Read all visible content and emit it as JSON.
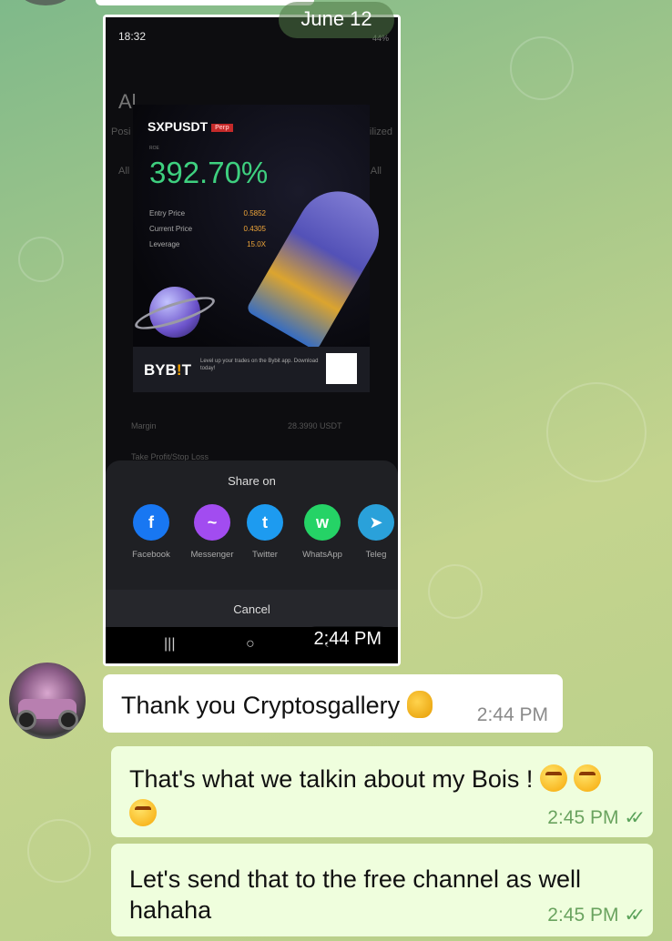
{
  "date_pill": "June 12",
  "screenshot": {
    "status_time": "18:32",
    "status_battery": "44%",
    "bg_letters": "Al",
    "bg_tab_left": "Posi",
    "bg_tab_right": "ilized",
    "bg_chip_left": "All",
    "bg_chip_right": "All",
    "bg_margin_label": "Margin",
    "bg_margin_value": "28.3990 USDT",
    "bg_tpsl_label": "Take Profit/Stop Loss",
    "card": {
      "pair": "SXPUSDT",
      "tag": "Perp",
      "roe_label": "ROE",
      "roe": "392.70%",
      "entry_label": "Entry Price",
      "entry_value": "0.5852",
      "current_label": "Current Price",
      "current_value": "0.4305",
      "leverage_label": "Leverage",
      "leverage_value": "15.0X",
      "logo_main": "BYB",
      "logo_accent": "!",
      "logo_end": "T",
      "tagline": "Level up your trades on the Bybit app. Download today!"
    },
    "share": {
      "title": "Share on",
      "items": [
        {
          "label": "Facebook",
          "icon": "facebook-icon",
          "color": "#1877f2",
          "glyph": "f"
        },
        {
          "label": "Messenger",
          "icon": "messenger-icon",
          "color": "#a24cf0",
          "glyph": "~"
        },
        {
          "label": "Twitter",
          "icon": "twitter-icon",
          "color": "#1d9bf0",
          "glyph": "t"
        },
        {
          "label": "WhatsApp",
          "icon": "whatsapp-icon",
          "color": "#25d366",
          "glyph": "w"
        },
        {
          "label": "Teleg",
          "icon": "telegram-icon",
          "color": "#2aa1da",
          "glyph": "➤"
        }
      ],
      "cancel": "Cancel"
    },
    "time": "2:44 PM"
  },
  "messages": [
    {
      "text": "Thank you Cryptosgallery",
      "time": "2:44 PM"
    },
    {
      "text": "That's what we talkin about my Bois !",
      "time": "2:45 PM"
    },
    {
      "text_line1": "Let's send that to the free channel as well",
      "text_line2": "hahaha",
      "time": "2:45 PM"
    }
  ],
  "colors": {
    "outgoing_bubble": "#effedd",
    "incoming_bubble": "#ffffff",
    "roe_green": "#3ed07f",
    "read_check": "#5aa25a"
  }
}
